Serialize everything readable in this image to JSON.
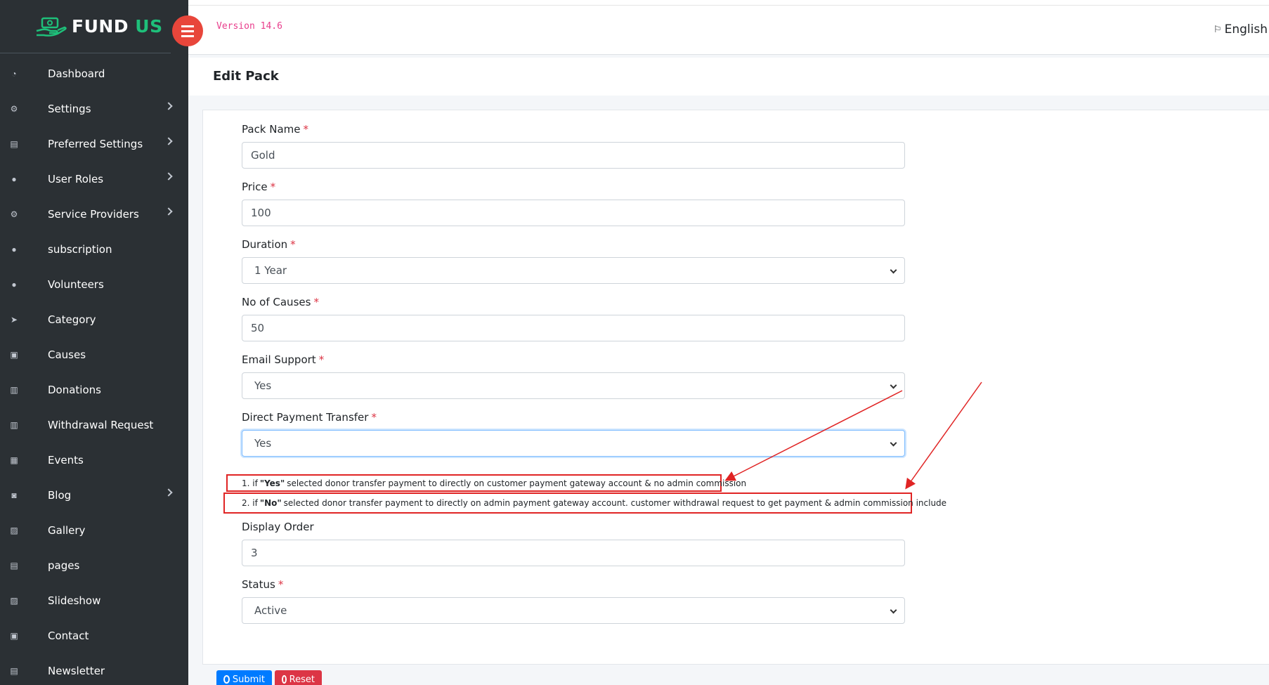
{
  "app": {
    "brand_left": "FUND",
    "brand_right": "US",
    "version": "Version 14.6",
    "language": "English"
  },
  "sidebar": {
    "items": [
      {
        "label": "Dashboard",
        "icon": "dashboard-icon",
        "has_children": false
      },
      {
        "label": "Settings",
        "icon": "gears-icon",
        "has_children": true
      },
      {
        "label": "Preferred Settings",
        "icon": "file-icon",
        "has_children": true
      },
      {
        "label": "User Roles",
        "icon": "users-icon",
        "has_children": true
      },
      {
        "label": "Service Providers",
        "icon": "gear-icon",
        "has_children": true
      },
      {
        "label": "subscription",
        "icon": "user-icon",
        "has_children": false
      },
      {
        "label": "Volunteers",
        "icon": "users-icon",
        "has_children": false
      },
      {
        "label": "Category",
        "icon": "location-arrow-icon",
        "has_children": false
      },
      {
        "label": "Causes",
        "icon": "gift-icon",
        "has_children": false
      },
      {
        "label": "Donations",
        "icon": "money-icon",
        "has_children": false
      },
      {
        "label": "Withdrawal Request",
        "icon": "money-icon",
        "has_children": false
      },
      {
        "label": "Events",
        "icon": "calendar-icon",
        "has_children": false
      },
      {
        "label": "Blog",
        "icon": "comments-icon",
        "has_children": true
      },
      {
        "label": "Gallery",
        "icon": "image-icon",
        "has_children": false
      },
      {
        "label": "pages",
        "icon": "file-icon",
        "has_children": false
      },
      {
        "label": "Slideshow",
        "icon": "image-icon",
        "has_children": false
      },
      {
        "label": "Contact",
        "icon": "address-book-icon",
        "has_children": false
      },
      {
        "label": "Newsletter",
        "icon": "newspaper-icon",
        "has_children": false
      }
    ]
  },
  "page": {
    "title": "Edit Pack"
  },
  "form": {
    "pack_name": {
      "label": "Pack Name",
      "value": "Gold"
    },
    "price": {
      "label": "Price",
      "value": "100"
    },
    "duration": {
      "label": "Duration",
      "value": "1 Year"
    },
    "no_of_causes": {
      "label": "No of Causes",
      "value": "50"
    },
    "email_support": {
      "label": "Email Support",
      "value": "Yes"
    },
    "direct_payment_transfer": {
      "label": "Direct Payment Transfer",
      "value": "Yes"
    },
    "display_order": {
      "label": "Display Order",
      "value": "3"
    },
    "status": {
      "label": "Status",
      "value": "Active"
    },
    "required_mark": "*"
  },
  "notes": {
    "yes": {
      "prefix": "1. if",
      "keyword": "\"Yes\"",
      "text": "selected donor transfer payment to directly on customer payment gateway account & no admin commission"
    },
    "no": {
      "prefix": "2. if",
      "keyword": "\"No\"",
      "text": "selected donor transfer payment to directly on admin payment gateway account. customer withdrawal request to get payment & admin commission include"
    }
  },
  "actions": {
    "submit": "Submit",
    "reset": "Reset"
  },
  "colors": {
    "sidebar_bg": "#2b3034",
    "brand_accent": "#1ec07a",
    "toggle_bg": "#e8463b",
    "annotation_red": "#e02424",
    "submit_blue": "#007bff",
    "reset_red": "#dc3545"
  }
}
